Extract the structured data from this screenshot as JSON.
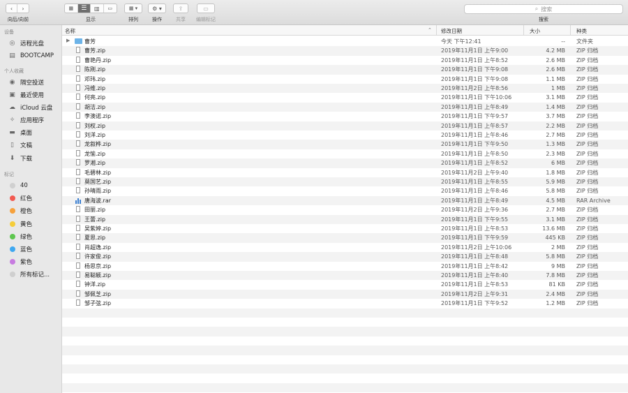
{
  "toolbar": {
    "nav_label": "向后/向前",
    "view_label": "显示",
    "arrange_label": "排列",
    "action_label": "操作",
    "share_label": "共享",
    "tags_label": "编辑标记",
    "search_label": "搜索",
    "search_placeholder": "搜索"
  },
  "sidebar": {
    "devices_header": "设备",
    "devices": [
      {
        "label": "远程光盘",
        "icon": "disc-icon"
      },
      {
        "label": "BOOTCAMP",
        "icon": "drive-icon"
      }
    ],
    "favorites_header": "个人收藏",
    "favorites": [
      {
        "label": "隔空投送",
        "icon": "airdrop-icon"
      },
      {
        "label": "最近使用",
        "icon": "recents-icon"
      },
      {
        "label": "iCloud 云盘",
        "icon": "cloud-icon"
      },
      {
        "label": "应用程序",
        "icon": "applications-icon"
      },
      {
        "label": "桌面",
        "icon": "desktop-icon"
      },
      {
        "label": "文稿",
        "icon": "documents-icon"
      },
      {
        "label": "下载",
        "icon": "downloads-icon"
      }
    ],
    "tags_header": "标记",
    "tags": [
      {
        "label": "40",
        "color": "#d0d0d0"
      },
      {
        "label": "红色",
        "color": "#f25a51"
      },
      {
        "label": "橙色",
        "color": "#f6a13b"
      },
      {
        "label": "黄色",
        "color": "#f5cd3a"
      },
      {
        "label": "绿色",
        "color": "#5ec64f"
      },
      {
        "label": "蓝色",
        "color": "#3fa8f0"
      },
      {
        "label": "紫色",
        "color": "#c77ce0"
      },
      {
        "label": "所有标记...",
        "color": "#cfcfcf"
      }
    ]
  },
  "columns": {
    "name": "名称",
    "date": "修改日期",
    "size": "大小",
    "kind": "种类"
  },
  "files": [
    {
      "name": "曹芳",
      "date": "今天 下午12:41",
      "size": "--",
      "kind": "文件夹",
      "type": "folder"
    },
    {
      "name": "曹芳.zip",
      "date": "2019年11月1日 上午9:00",
      "size": "4.2 MB",
      "kind": "ZIP 归档",
      "type": "zip"
    },
    {
      "name": "曹艳丹.zip",
      "date": "2019年11月1日 上午8:52",
      "size": "2.6 MB",
      "kind": "ZIP 归档",
      "type": "zip"
    },
    {
      "name": "陈刚.zip",
      "date": "2019年11月1日 下午9:08",
      "size": "2.6 MB",
      "kind": "ZIP 归档",
      "type": "zip"
    },
    {
      "name": "邓玮.zip",
      "date": "2019年11月1日 下午9:08",
      "size": "1.1 MB",
      "kind": "ZIP 归档",
      "type": "zip"
    },
    {
      "name": "冯维.zip",
      "date": "2019年11月2日 上午8:56",
      "size": "1 MB",
      "kind": "ZIP 归档",
      "type": "zip"
    },
    {
      "name": "何亮.zip",
      "date": "2019年11月1日 下午10:06",
      "size": "3.1 MB",
      "kind": "ZIP 归档",
      "type": "zip"
    },
    {
      "name": "胡洁.zip",
      "date": "2019年11月1日 上午8:49",
      "size": "1.4 MB",
      "kind": "ZIP 归档",
      "type": "zip"
    },
    {
      "name": "李澳诺.zip",
      "date": "2019年11月1日 下午9:57",
      "size": "3.7 MB",
      "kind": "ZIP 归档",
      "type": "zip"
    },
    {
      "name": "刘权.zip",
      "date": "2019年11月1日 上午8:57",
      "size": "2.2 MB",
      "kind": "ZIP 归档",
      "type": "zip"
    },
    {
      "name": "刘洋.zip",
      "date": "2019年11月1日 上午8:46",
      "size": "2.7 MB",
      "kind": "ZIP 归档",
      "type": "zip"
    },
    {
      "name": "龙叙桦.zip",
      "date": "2019年11月1日 下午9:50",
      "size": "1.3 MB",
      "kind": "ZIP 归档",
      "type": "zip"
    },
    {
      "name": "龙愉.zip",
      "date": "2019年11月1日 上午8:50",
      "size": "2.3 MB",
      "kind": "ZIP 归档",
      "type": "zip"
    },
    {
      "name": "罗湘.zip",
      "date": "2019年11月1日 上午8:52",
      "size": "6 MB",
      "kind": "ZIP 归档",
      "type": "zip"
    },
    {
      "name": "毛碧林.zip",
      "date": "2019年11月2日 上午9:40",
      "size": "1.8 MB",
      "kind": "ZIP 归档",
      "type": "zip"
    },
    {
      "name": "莫国艺.zip",
      "date": "2019年11月1日 上午8:55",
      "size": "5.9 MB",
      "kind": "ZIP 归档",
      "type": "zip"
    },
    {
      "name": "孙晴雨.zip",
      "date": "2019年11月1日 上午8:46",
      "size": "5.8 MB",
      "kind": "ZIP 归档",
      "type": "zip"
    },
    {
      "name": "唐海波.rar",
      "date": "2019年11月1日 上午8:49",
      "size": "4.5 MB",
      "kind": "RAR Archive",
      "type": "rar"
    },
    {
      "name": "田丽.zip",
      "date": "2019年11月2日 上午9:36",
      "size": "2.7 MB",
      "kind": "ZIP 归档",
      "type": "zip"
    },
    {
      "name": "王蕾.zip",
      "date": "2019年11月1日 下午9:55",
      "size": "3.1 MB",
      "kind": "ZIP 归档",
      "type": "zip"
    },
    {
      "name": "吴紫婷.zip",
      "date": "2019年11月1日 上午8:53",
      "size": "13.6 MB",
      "kind": "ZIP 归档",
      "type": "zip"
    },
    {
      "name": "夏思.zip",
      "date": "2019年11月1日 下午9:59",
      "size": "445 KB",
      "kind": "ZIP 归档",
      "type": "zip"
    },
    {
      "name": "肖超逸.zip",
      "date": "2019年11月2日 上午10:06",
      "size": "2 MB",
      "kind": "ZIP 归档",
      "type": "zip"
    },
    {
      "name": "许家俊.zip",
      "date": "2019年11月1日 上午8:48",
      "size": "5.8 MB",
      "kind": "ZIP 归档",
      "type": "zip"
    },
    {
      "name": "杨思京.zip",
      "date": "2019年11月1日 上午8:42",
      "size": "9 MB",
      "kind": "ZIP 归档",
      "type": "zip"
    },
    {
      "name": "易聪颖.zip",
      "date": "2019年11月1日 上午8:40",
      "size": "7.8 MB",
      "kind": "ZIP 归档",
      "type": "zip"
    },
    {
      "name": "钟洋.zip",
      "date": "2019年11月1日 上午8:53",
      "size": "81 KB",
      "kind": "ZIP 归档",
      "type": "zip"
    },
    {
      "name": "邹佩芝.zip",
      "date": "2019年11月2日 上午9:31",
      "size": "2.4 MB",
      "kind": "ZIP 归档",
      "type": "zip"
    },
    {
      "name": "邹子弦.zip",
      "date": "2019年11月1日 下午9:52",
      "size": "1.2 MB",
      "kind": "ZIP 归档",
      "type": "zip"
    }
  ]
}
